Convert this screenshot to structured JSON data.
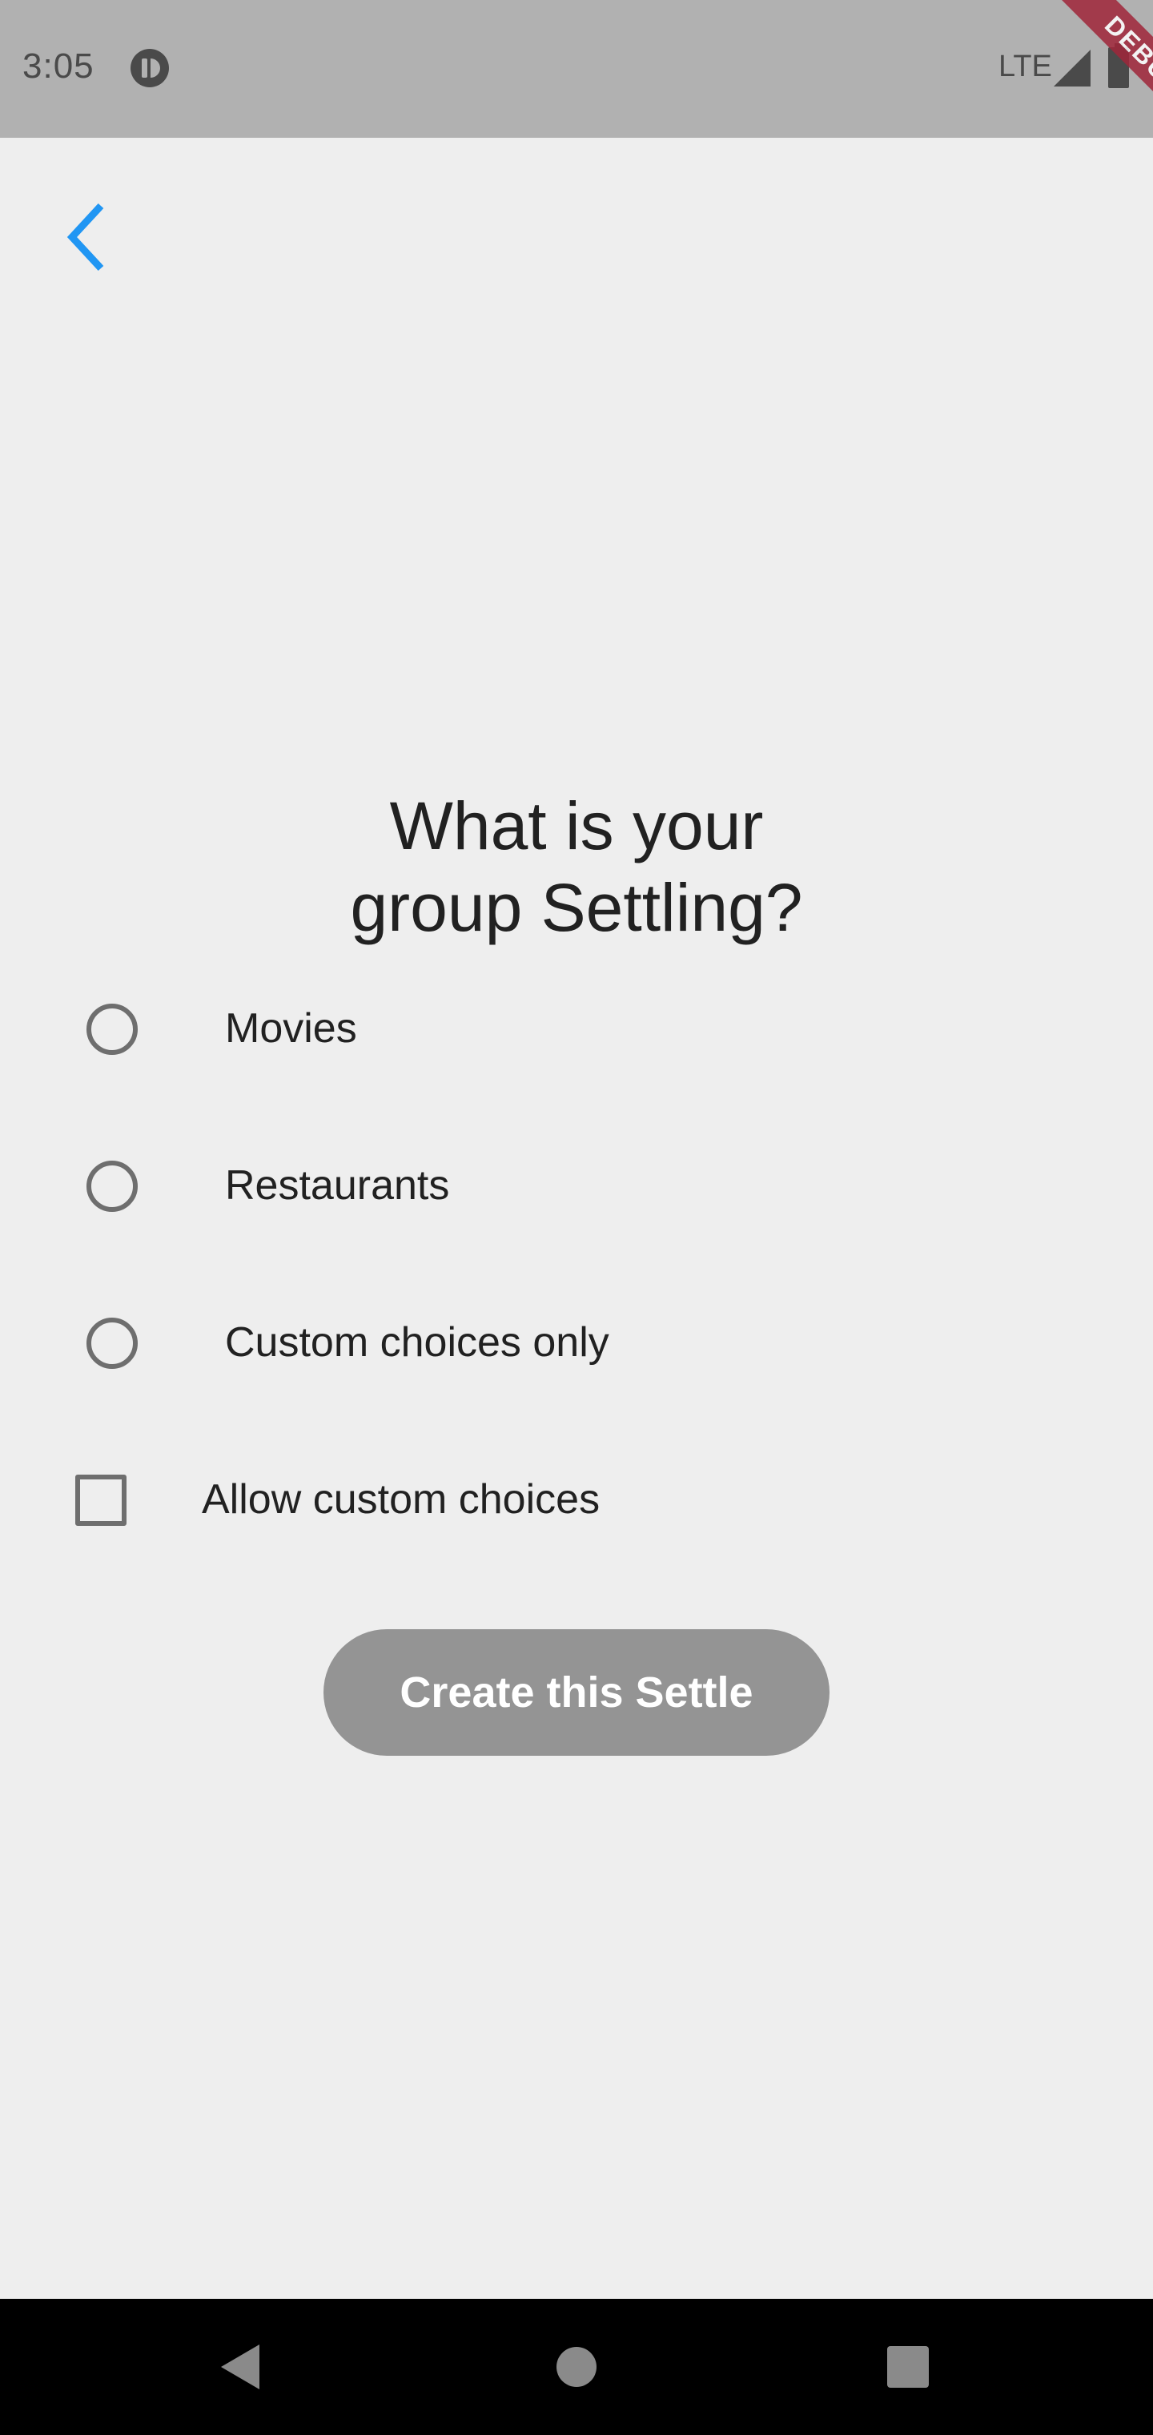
{
  "status_bar": {
    "time": "3:05",
    "network": "LTE",
    "debug_banner": "DEBUG",
    "icons": [
      "app-notification-icon",
      "signal-icon",
      "battery-icon"
    ]
  },
  "header": {
    "back_icon": "chevron-left-icon",
    "accent_color": "#2196f3"
  },
  "main": {
    "heading_line1": "What is your",
    "heading_line2": "group Settling?",
    "options": [
      {
        "label": "Movies",
        "selected": false
      },
      {
        "label": "Restaurants",
        "selected": false
      },
      {
        "label": "Custom choices only",
        "selected": false
      }
    ],
    "allow_custom": {
      "label": "Allow custom choices",
      "checked": false
    },
    "create_button_label": "Create this Settle",
    "create_button_color": "#949494"
  },
  "nav_bar": {
    "buttons": [
      "back-triangle-icon",
      "home-circle-icon",
      "recents-square-icon"
    ]
  }
}
